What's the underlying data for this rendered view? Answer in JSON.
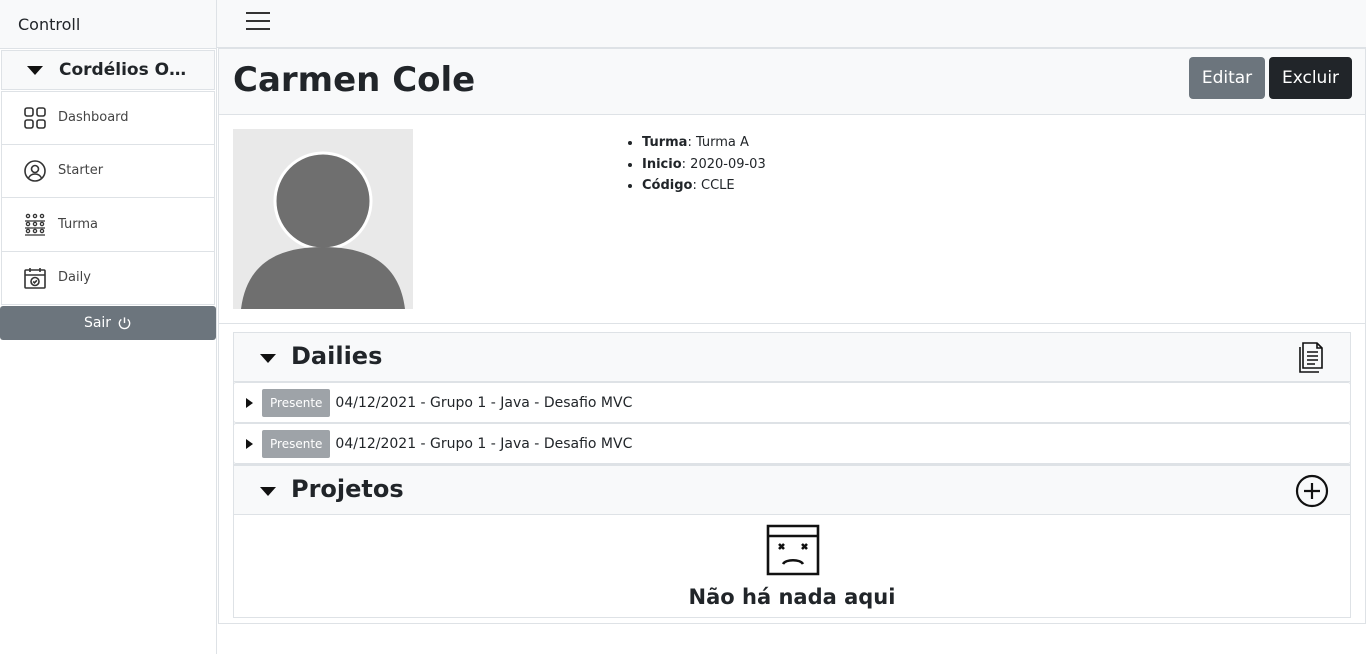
{
  "app": {
    "brand": "Controll"
  },
  "sidebar": {
    "user_name": "Cordélios Obe...",
    "items": [
      {
        "label": "Dashboard",
        "icon": "dashboard-icon"
      },
      {
        "label": "Starter",
        "icon": "user-circle-icon"
      },
      {
        "label": "Turma",
        "icon": "group-icon"
      },
      {
        "label": "Daily",
        "icon": "calendar-check-icon"
      }
    ],
    "logout_label": "Sair"
  },
  "header": {
    "title": "Carmen Cole",
    "edit_label": "Editar",
    "delete_label": "Excluir"
  },
  "profile": {
    "details": [
      {
        "key": "Turma",
        "value": ": Turma A"
      },
      {
        "key": "Inicio",
        "value": ": 2020-09-03"
      },
      {
        "key": "Código",
        "value": ": CCLE"
      }
    ]
  },
  "dailies": {
    "title": "Dailies",
    "items": [
      {
        "status": "Presente",
        "text": "04/12/2021 - Grupo 1 - Java - Desafio MVC"
      },
      {
        "status": "Presente",
        "text": "04/12/2021 - Grupo 1 - Java - Desafio MVC"
      }
    ]
  },
  "projetos": {
    "title": "Projetos",
    "empty_message": "Não há nada aqui"
  },
  "colors": {
    "secondary": "#6c757d",
    "dark": "#212529",
    "badge": "#9ea3a8"
  }
}
